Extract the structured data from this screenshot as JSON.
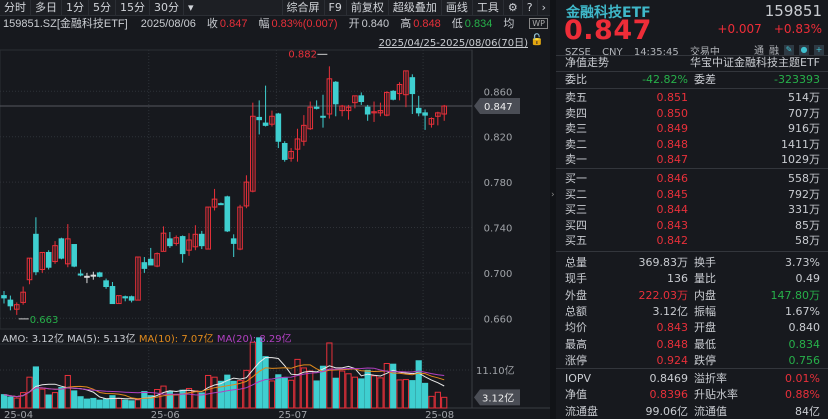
{
  "toolbar": {
    "left": [
      "分时",
      "多日",
      "1分",
      "5分",
      "15分",
      "30分"
    ],
    "dropdown": "▾",
    "right": [
      "综合屏",
      "F9",
      "前复权",
      "超级叠加",
      "画线",
      "工具"
    ],
    "gear": "⚙",
    "help": "?",
    "next": "›"
  },
  "info": {
    "symbol": "159851.SZ[金融科技ETF]",
    "date": "2025/08/06",
    "close_label": "收",
    "close": "0.847",
    "amp_label": "幅",
    "amp": "0.83%(0.007)",
    "open_label": "开",
    "open": "0.840",
    "high_label": "高",
    "high": "0.848",
    "low_label": "低",
    "low": "0.834",
    "avg_label": "均",
    "wp": "WP"
  },
  "range": "2025/04/25-2025/08/06(70日)",
  "colors": {
    "up": "#e8303a",
    "down": "#3fcfd0",
    "bg": "#17191e",
    "ma5": "#e8e8e8",
    "ma10": "#e08a1c",
    "ma20": "#b040c0"
  },
  "chart_data": {
    "type": "candlestick",
    "ylim": [
      0.652,
      0.892
    ],
    "yticks": [
      "0.860",
      "0.820",
      "0.780",
      "0.740",
      "0.700",
      "0.660"
    ],
    "current_price": "0.847",
    "max_label": "0.882",
    "min_label": "0.663",
    "xticks": [
      {
        "label": "25-04",
        "index": 0
      },
      {
        "label": "25-06",
        "index": 23
      },
      {
        "label": "25-07",
        "index": 43
      },
      {
        "label": "25-08",
        "index": 66
      }
    ],
    "candles": [
      [
        0.68,
        0.684,
        0.673,
        0.678
      ],
      [
        0.676,
        0.68,
        0.667,
        0.671
      ],
      [
        0.668,
        0.674,
        0.663,
        0.672
      ],
      [
        0.674,
        0.688,
        0.672,
        0.683
      ],
      [
        0.694,
        0.713,
        0.69,
        0.713
      ],
      [
        0.734,
        0.749,
        0.698,
        0.701
      ],
      [
        0.703,
        0.718,
        0.7,
        0.718
      ],
      [
        0.718,
        0.72,
        0.703,
        0.705
      ],
      [
        0.71,
        0.728,
        0.708,
        0.724
      ],
      [
        0.73,
        0.731,
        0.712,
        0.713
      ],
      [
        0.708,
        0.743,
        0.705,
        0.73
      ],
      [
        0.725,
        0.725,
        0.705,
        0.706
      ],
      [
        0.699,
        0.703,
        0.697,
        0.699
      ],
      [
        0.697,
        0.7,
        0.691,
        0.697
      ],
      [
        0.698,
        0.701,
        0.694,
        0.698
      ],
      [
        0.7,
        0.701,
        0.696,
        0.697
      ],
      [
        0.693,
        0.695,
        0.686,
        0.688
      ],
      [
        0.688,
        0.692,
        0.673,
        0.673
      ],
      [
        0.673,
        0.68,
        0.673,
        0.68
      ],
      [
        0.679,
        0.68,
        0.675,
        0.678
      ],
      [
        0.679,
        0.68,
        0.674,
        0.676
      ],
      [
        0.676,
        0.714,
        0.676,
        0.714
      ],
      [
        0.709,
        0.714,
        0.7,
        0.704
      ],
      [
        0.712,
        0.722,
        0.707,
        0.707
      ],
      [
        0.706,
        0.718,
        0.705,
        0.717
      ],
      [
        0.719,
        0.741,
        0.719,
        0.735
      ],
      [
        0.73,
        0.736,
        0.722,
        0.724
      ],
      [
        0.726,
        0.733,
        0.724,
        0.731
      ],
      [
        0.732,
        0.733,
        0.709,
        0.717
      ],
      [
        0.72,
        0.735,
        0.715,
        0.729
      ],
      [
        0.723,
        0.742,
        0.72,
        0.734
      ],
      [
        0.734,
        0.737,
        0.721,
        0.724
      ],
      [
        0.721,
        0.758,
        0.721,
        0.758
      ],
      [
        0.758,
        0.774,
        0.755,
        0.765
      ],
      [
        0.761,
        0.762,
        0.76,
        0.761
      ],
      [
        0.767,
        0.768,
        0.736,
        0.737
      ],
      [
        0.73,
        0.734,
        0.714,
        0.726
      ],
      [
        0.721,
        0.76,
        0.72,
        0.758
      ],
      [
        0.759,
        0.786,
        0.757,
        0.78
      ],
      [
        0.772,
        0.85,
        0.771,
        0.838
      ],
      [
        0.837,
        0.852,
        0.822,
        0.835
      ],
      [
        0.832,
        0.865,
        0.829,
        0.83
      ],
      [
        0.831,
        0.843,
        0.829,
        0.838
      ],
      [
        0.84,
        0.841,
        0.81,
        0.816
      ],
      [
        0.814,
        0.816,
        0.798,
        0.8
      ],
      [
        0.801,
        0.81,
        0.798,
        0.807
      ],
      [
        0.809,
        0.827,
        0.798,
        0.818
      ],
      [
        0.816,
        0.839,
        0.812,
        0.83
      ],
      [
        0.827,
        0.851,
        0.826,
        0.846
      ],
      [
        0.846,
        0.852,
        0.844,
        0.845
      ],
      [
        0.838,
        0.857,
        0.828,
        0.838
      ],
      [
        0.84,
        0.882,
        0.836,
        0.871
      ],
      [
        0.868,
        0.869,
        0.838,
        0.849
      ],
      [
        0.843,
        0.848,
        0.838,
        0.847
      ],
      [
        0.843,
        0.848,
        0.835,
        0.846
      ],
      [
        0.85,
        0.856,
        0.845,
        0.856
      ],
      [
        0.856,
        0.859,
        0.848,
        0.851
      ],
      [
        0.846,
        0.848,
        0.834,
        0.84
      ],
      [
        0.841,
        0.851,
        0.833,
        0.842
      ],
      [
        0.841,
        0.85,
        0.838,
        0.843
      ],
      [
        0.839,
        0.86,
        0.838,
        0.859
      ],
      [
        0.86,
        0.861,
        0.852,
        0.853
      ],
      [
        0.858,
        0.868,
        0.852,
        0.866
      ],
      [
        0.857,
        0.878,
        0.846,
        0.878
      ],
      [
        0.872,
        0.875,
        0.84,
        0.858
      ],
      [
        0.845,
        0.856,
        0.838,
        0.841
      ],
      [
        0.841,
        0.844,
        0.826,
        0.839
      ],
      [
        0.831,
        0.837,
        0.828,
        0.836
      ],
      [
        0.838,
        0.842,
        0.83,
        0.841
      ],
      [
        0.84,
        0.848,
        0.834,
        0.847
      ]
    ],
    "volume_unit": "亿",
    "volume_tick": "11.10亿",
    "volume_current": "3.12亿",
    "volumes": [
      3.9,
      3.2,
      2.9,
      4.5,
      9.0,
      12.0,
      5.5,
      3.8,
      4.5,
      6.0,
      9.5,
      5.0,
      3.3,
      2.6,
      2.8,
      2.3,
      2.6,
      3.6,
      2.8,
      2.3,
      2.1,
      2.4,
      4.8,
      3.6,
      5.4,
      6.4,
      4.9,
      3.8,
      5.2,
      5.7,
      5.0,
      4.4,
      9.5,
      9.0,
      7.8,
      9.6,
      7.8,
      8.0,
      11.0,
      19.2,
      20.5,
      15.0,
      7.9,
      9.7,
      8.7,
      8.1,
      14.2,
      11.7,
      10.8,
      7.9,
      12.2,
      19.0,
      8.7,
      10.8,
      10.0,
      9.0,
      8.5,
      11.0,
      9.4,
      8.8,
      13.0,
      12.8,
      8.2,
      8.3,
      8.0,
      13.8,
      7.2,
      3.4,
      4.6,
      3.12
    ],
    "amo_label": "AMO: 3.12亿",
    "ma5_label": "MA(5): 5.13亿",
    "ma10_label": "MA(10): 7.07亿",
    "ma20_label": "MA(20): 8.29亿"
  },
  "panel": {
    "name": "金融科技ETF",
    "code": "159851",
    "price": "0.847",
    "change": "+0.007",
    "change_pct": "+0.83%",
    "exchange": "SZSE",
    "currency": "CNY",
    "time": "14:35:45",
    "status": "交易中",
    "tong": "通",
    "rong": "融",
    "nav_trend": "净值走势",
    "fullname": "华宝中证金融科技主题ETF",
    "wb_label": "委比",
    "wb": "-42.82%",
    "wc_label": "委差",
    "wc": "-323393",
    "asks": [
      {
        "label": "卖五",
        "price": "0.851",
        "vol": "514万"
      },
      {
        "label": "卖四",
        "price": "0.850",
        "vol": "707万"
      },
      {
        "label": "卖三",
        "price": "0.849",
        "vol": "916万"
      },
      {
        "label": "卖二",
        "price": "0.848",
        "vol": "1411万"
      },
      {
        "label": "卖一",
        "price": "0.847",
        "vol": "1029万"
      }
    ],
    "bids": [
      {
        "label": "买一",
        "price": "0.846",
        "vol": "558万"
      },
      {
        "label": "买二",
        "price": "0.845",
        "vol": "792万"
      },
      {
        "label": "买三",
        "price": "0.844",
        "vol": "331万"
      },
      {
        "label": "买四",
        "price": "0.843",
        "vol": "85万"
      },
      {
        "label": "买五",
        "price": "0.842",
        "vol": "58万"
      }
    ],
    "stats": [
      {
        "l1": "总量",
        "v1": "369.83万",
        "c1": "",
        "l2": "换手",
        "v2": "3.73%",
        "c2": ""
      },
      {
        "l1": "现手",
        "v1": "136",
        "c1": "",
        "l2": "量比",
        "v2": "0.49",
        "c2": ""
      },
      {
        "l1": "外盘",
        "v1": "222.03万",
        "c1": "red",
        "l2": "内盘",
        "v2": "147.80万",
        "c2": "green"
      },
      {
        "l1": "总额",
        "v1": "3.12亿",
        "c1": "",
        "l2": "振幅",
        "v2": "1.67%",
        "c2": ""
      },
      {
        "l1": "均价",
        "v1": "0.843",
        "c1": "red",
        "l2": "开盘",
        "v2": "0.840",
        "c2": ""
      },
      {
        "l1": "最高",
        "v1": "0.848",
        "c1": "red",
        "l2": "最低",
        "v2": "0.834",
        "c2": "green"
      },
      {
        "l1": "涨停",
        "v1": "0.924",
        "c1": "red",
        "l2": "跌停",
        "v2": "0.756",
        "c2": "green"
      }
    ],
    "fund": [
      {
        "l1": "IOPV",
        "v1": "0.8469",
        "c1": "",
        "l2": "溢折率",
        "v2": "0.01%",
        "c2": "red"
      },
      {
        "l1": "净值",
        "v1": "0.8396",
        "c1": "red",
        "l2": "升贴水率",
        "v2": "0.88%",
        "c2": "red"
      },
      {
        "l1": "流通盘",
        "v1": "99.06亿",
        "c1": "",
        "l2": "流通值",
        "v2": "84亿",
        "c2": ""
      }
    ]
  }
}
